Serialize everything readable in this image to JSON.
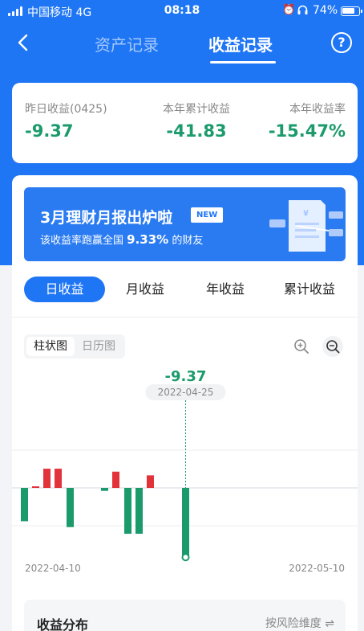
{
  "status_bar": {
    "carrier": "中国移动  4G",
    "time": "08:18",
    "battery_pct": "74%"
  },
  "nav": {
    "tab_assets": "资产记录",
    "tab_earnings": "收益记录",
    "help": "?"
  },
  "summary": {
    "yesterday_label": "昨日收益(0425)",
    "yesterday_value": "-9.37",
    "ytd_label": "本年累计收益",
    "ytd_value": "-41.83",
    "rate_label": "本年收益率",
    "rate_value": "-15.47%"
  },
  "banner": {
    "title": "3月理财月报出炉啦",
    "badge": "NEW",
    "sub_prefix": "该收益率跑赢全国 ",
    "sub_value": "9.33%",
    "sub_suffix": " 的财友"
  },
  "period_tabs": [
    "日收益",
    "月收益",
    "年收益",
    "累计收益"
  ],
  "view_toggle": [
    "柱状图",
    "日历图"
  ],
  "chart_data": {
    "type": "bar",
    "selected_value": "-9.37",
    "selected_date": "2022-04-25",
    "x_start_label": "2022-04-10",
    "x_end_label": "2022-05-10",
    "colors": {
      "positive": "#e2333b",
      "negative": "#1b9a6c"
    },
    "values": [
      -4.5,
      0.2,
      2.6,
      2.6,
      -5.3,
      -0.4,
      2.2,
      -6.2,
      -6.2,
      1.7,
      -9.37
    ]
  },
  "distribution": {
    "title": "收益分布",
    "filter": "按风险维度",
    "filter_icon": "swap-icon"
  }
}
